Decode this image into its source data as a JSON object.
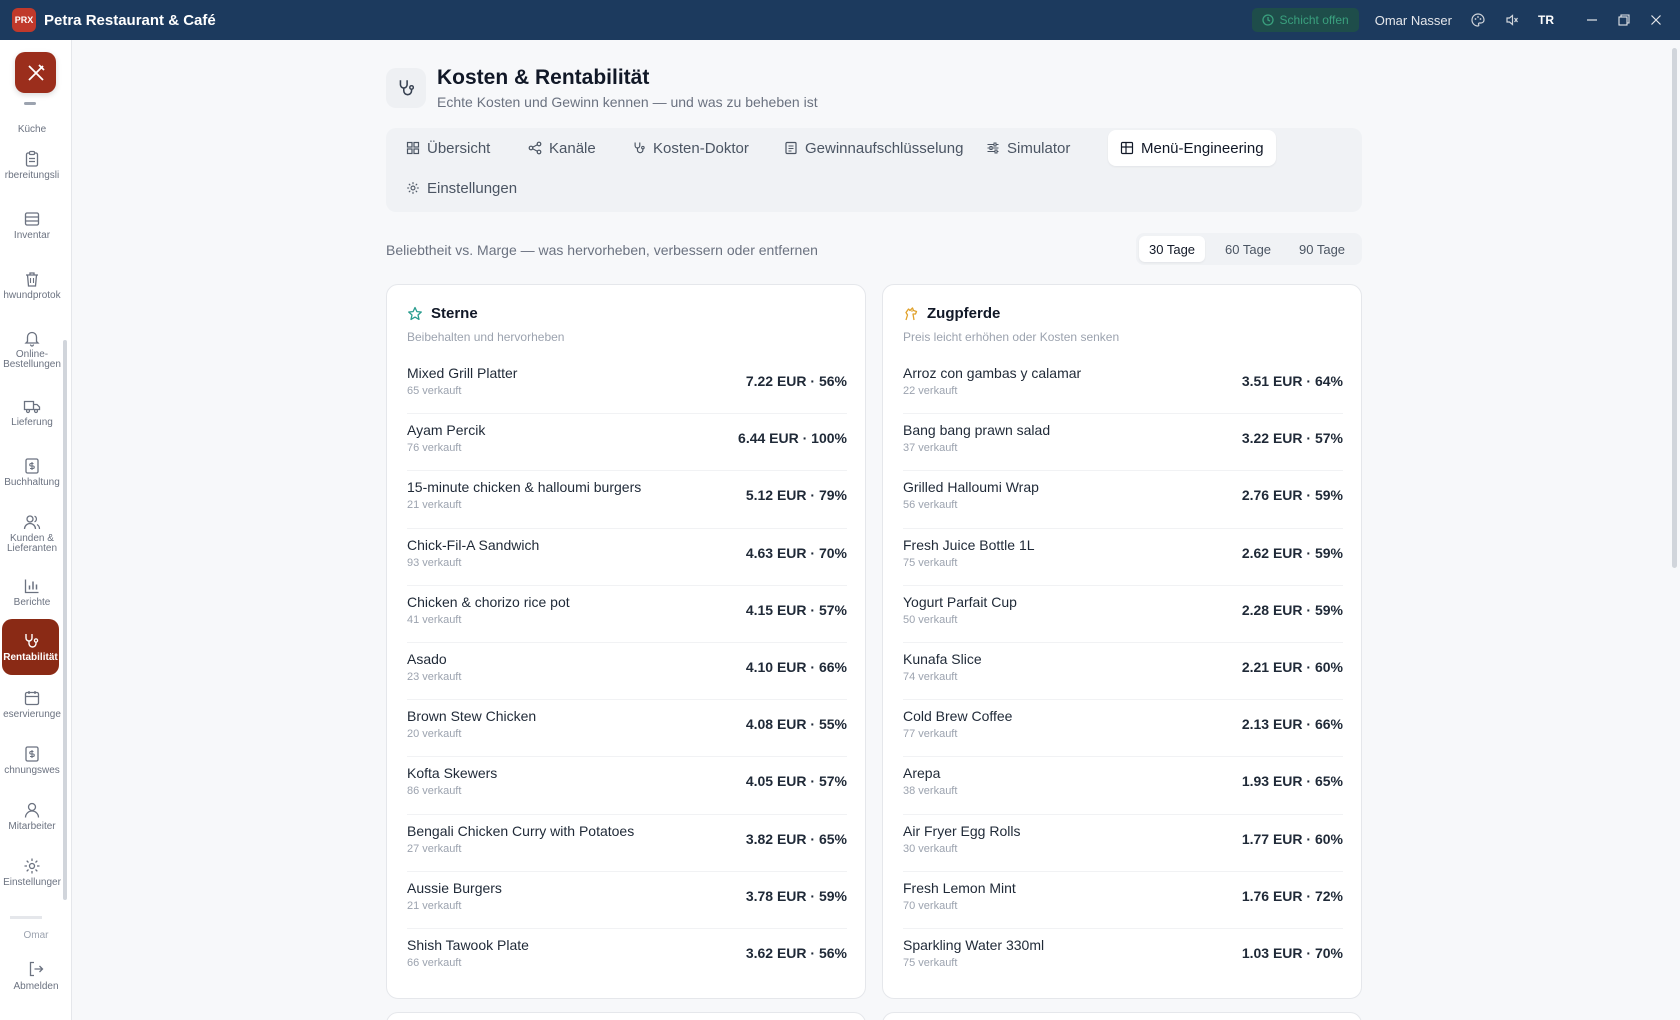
{
  "app": {
    "logo_text": "PRX",
    "title": "Petra Restaurant & Café"
  },
  "titlebar": {
    "shift_status": "Schicht offen",
    "user": "Omar Nasser",
    "language": "TR"
  },
  "sidebar": {
    "items": [
      {
        "label": "Küche"
      },
      {
        "label": "rbereitungsli"
      },
      {
        "label": "Inventar"
      },
      {
        "label": "hwundprotok"
      },
      {
        "label": "Online-\nBestellungen"
      },
      {
        "label": "Lieferung"
      },
      {
        "label": "Buchhaltung"
      },
      {
        "label": "Kunden &\nLieferanten"
      },
      {
        "label": "Berichte"
      },
      {
        "label": "Rentabilität"
      },
      {
        "label": "eservierunge"
      },
      {
        "label": "chnungswes"
      },
      {
        "label": "Mitarbeiter"
      },
      {
        "label": "Einstellunger"
      }
    ],
    "user_label": "Omar",
    "logout_label": "Abmelden"
  },
  "page": {
    "title": "Kosten & Rentabilität",
    "subtitle": "Echte Kosten und Gewinn kennen — und was zu beheben ist"
  },
  "tabs": [
    {
      "label": "Übersicht"
    },
    {
      "label": "Kanäle"
    },
    {
      "label": "Kosten-Doktor"
    },
    {
      "label": "Gewinnaufschlüsselung"
    },
    {
      "label": "Simulator"
    },
    {
      "label": "Menü-Engineering"
    },
    {
      "label": "Einstellungen"
    }
  ],
  "section": {
    "description": "Beliebtheit vs. Marge — was hervorheben, verbessern oder entfernen"
  },
  "periods": [
    {
      "label": "30 Tage"
    },
    {
      "label": "60 Tage"
    },
    {
      "label": "90 Tage"
    }
  ],
  "cards": {
    "stars": {
      "title": "Sterne",
      "subtitle": "Beibehalten und hervorheben",
      "items": [
        {
          "name": "Mixed Grill Platter",
          "sold": "65 verkauft",
          "value": "7.22 EUR · 56%"
        },
        {
          "name": "Ayam Percik",
          "sold": "76 verkauft",
          "value": "6.44 EUR · 100%"
        },
        {
          "name": "15-minute chicken & halloumi burgers",
          "sold": "21 verkauft",
          "value": "5.12 EUR · 79%"
        },
        {
          "name": "Chick-Fil-A Sandwich",
          "sold": "93 verkauft",
          "value": "4.63 EUR · 70%"
        },
        {
          "name": "Chicken & chorizo rice pot",
          "sold": "41 verkauft",
          "value": "4.15 EUR · 57%"
        },
        {
          "name": "Asado",
          "sold": "23 verkauft",
          "value": "4.10 EUR · 66%"
        },
        {
          "name": "Brown Stew Chicken",
          "sold": "20 verkauft",
          "value": "4.08 EUR · 55%"
        },
        {
          "name": "Kofta Skewers",
          "sold": "86 verkauft",
          "value": "4.05 EUR · 57%"
        },
        {
          "name": "Bengali Chicken Curry with Potatoes",
          "sold": "27 verkauft",
          "value": "3.82 EUR · 65%"
        },
        {
          "name": "Aussie Burgers",
          "sold": "21 verkauft",
          "value": "3.78 EUR · 59%"
        },
        {
          "name": "Shish Tawook Plate",
          "sold": "66 verkauft",
          "value": "3.62 EUR · 56%"
        }
      ]
    },
    "plowhorses": {
      "title": "Zugpferde",
      "subtitle": "Preis leicht erhöhen oder Kosten senken",
      "items": [
        {
          "name": "Arroz con gambas y calamar",
          "sold": "22 verkauft",
          "value": "3.51 EUR · 64%"
        },
        {
          "name": "Bang bang prawn salad",
          "sold": "37 verkauft",
          "value": "3.22 EUR · 57%"
        },
        {
          "name": "Grilled Halloumi Wrap",
          "sold": "56 verkauft",
          "value": "2.76 EUR · 59%"
        },
        {
          "name": "Fresh Juice Bottle 1L",
          "sold": "75 verkauft",
          "value": "2.62 EUR · 59%"
        },
        {
          "name": "Yogurt Parfait Cup",
          "sold": "50 verkauft",
          "value": "2.28 EUR · 59%"
        },
        {
          "name": "Kunafa Slice",
          "sold": "74 verkauft",
          "value": "2.21 EUR · 60%"
        },
        {
          "name": "Cold Brew Coffee",
          "sold": "77 verkauft",
          "value": "2.13 EUR · 66%"
        },
        {
          "name": "Arepa",
          "sold": "38 verkauft",
          "value": "1.93 EUR · 65%"
        },
        {
          "name": "Air Fryer Egg Rolls",
          "sold": "30 verkauft",
          "value": "1.77 EUR · 60%"
        },
        {
          "name": "Fresh Lemon Mint",
          "sold": "70 verkauft",
          "value": "1.76 EUR · 72%"
        },
        {
          "name": "Sparkling Water 330ml",
          "sold": "75 verkauft",
          "value": "1.03 EUR · 70%"
        }
      ]
    }
  },
  "colors": {
    "titlebar": "#1c3a5e",
    "accent": "#8a2a15",
    "star": "#2a9d8f",
    "plowhorse": "#e0a12b"
  }
}
